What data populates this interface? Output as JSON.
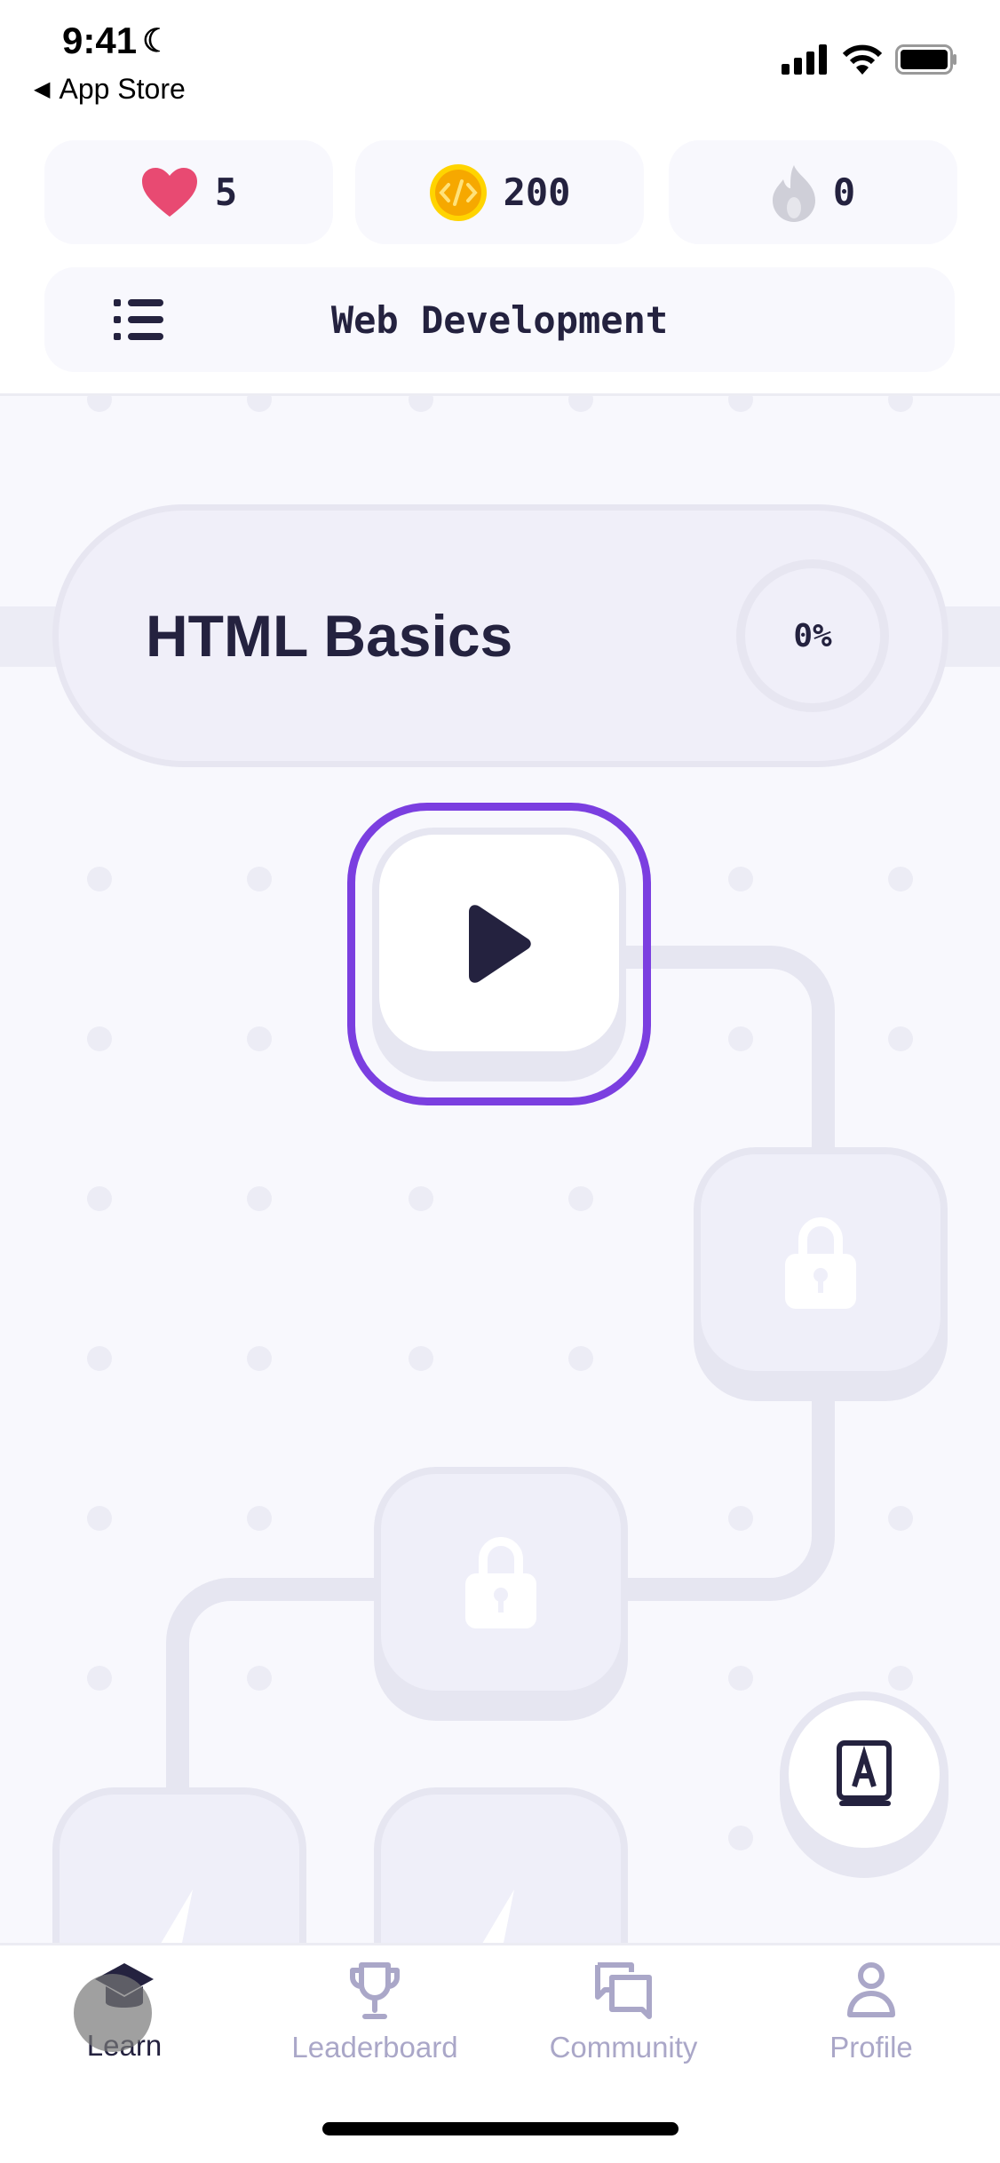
{
  "status_bar": {
    "time": "9:41",
    "back_label": "App Store"
  },
  "stats": {
    "hearts": "5",
    "coins": "200",
    "streak": "0"
  },
  "header": {
    "course_title": "Web Development"
  },
  "unit": {
    "title": "HTML Basics",
    "progress": "0%",
    "progress_value": 0
  },
  "lessons": [
    {
      "state": "active",
      "icon": "play-icon"
    },
    {
      "state": "locked",
      "icon": "lock-icon"
    },
    {
      "state": "locked",
      "icon": "lock-icon"
    },
    {
      "state": "locked",
      "icon": "lightning-icon"
    },
    {
      "state": "locked",
      "icon": "lightning-icon"
    }
  ],
  "tabs": [
    {
      "label": "Learn",
      "icon": "graduation-cap-icon",
      "active": true
    },
    {
      "label": "Leaderboard",
      "icon": "trophy-icon"
    },
    {
      "label": "Community",
      "icon": "chat-bubbles-icon"
    },
    {
      "label": "Profile",
      "icon": "person-icon"
    }
  ],
  "colors": {
    "accent": "#7b3fe0",
    "text": "#24223f",
    "heart": "#e84a72",
    "coin": "#f6b800",
    "inactive": "#aaa7c8"
  }
}
